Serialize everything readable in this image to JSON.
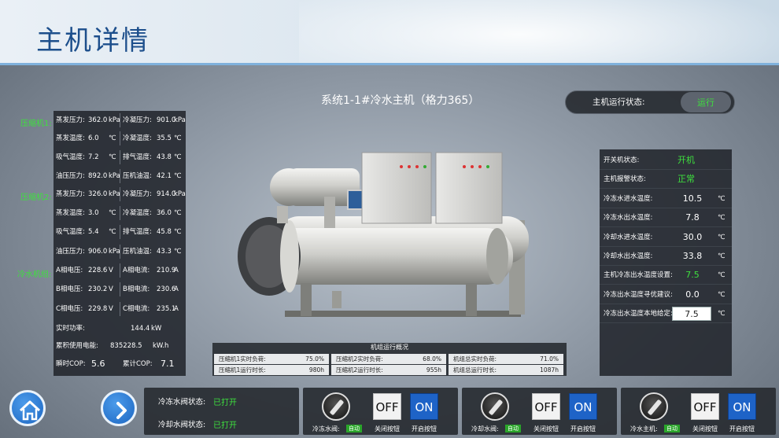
{
  "header": {
    "title": "主机详情"
  },
  "system_title": "系统1-1#冷水主机（格力365）",
  "run_status": {
    "label": "主机运行状态:",
    "value": "运行"
  },
  "compressor_groups": [
    {
      "label": "压缩机1:"
    },
    {
      "label": "压缩机2:"
    },
    {
      "label": "冷水机组:"
    }
  ],
  "left_rows": [
    {
      "k1": "蒸发压力:",
      "v1": "362.0",
      "u1": "kPa",
      "k2": "冷凝压力:",
      "v2": "901.0",
      "u2": "kPa"
    },
    {
      "k1": "蒸发温度:",
      "v1": "6.0",
      "u1": "℃",
      "k2": "冷凝温度:",
      "v2": "35.5",
      "u2": "℃"
    },
    {
      "k1": "吸气温度:",
      "v1": "7.2",
      "u1": "℃",
      "k2": "排气温度:",
      "v2": "43.8",
      "u2": "℃"
    },
    {
      "k1": "油压压力:",
      "v1": "892.0",
      "u1": "kPa",
      "k2": "压机油温:",
      "v2": "42.1",
      "u2": "℃"
    },
    {
      "k1": "蒸发压力:",
      "v1": "326.0",
      "u1": "kPa",
      "k2": "冷凝压力:",
      "v2": "914.0",
      "u2": "kPa"
    },
    {
      "k1": "蒸发温度:",
      "v1": "3.0",
      "u1": "℃",
      "k2": "冷凝温度:",
      "v2": "36.0",
      "u2": "℃"
    },
    {
      "k1": "吸气温度:",
      "v1": "5.4",
      "u1": "℃",
      "k2": "排气温度:",
      "v2": "45.8",
      "u2": "℃"
    },
    {
      "k1": "油压压力:",
      "v1": "906.0",
      "u1": "kPa",
      "k2": "压机油温:",
      "v2": "43.3",
      "u2": "℃"
    },
    {
      "k1": "A相电压:",
      "v1": "228.6",
      "u1": "V",
      "k2": "A相电流:",
      "v2": "210.9",
      "u2": "A"
    },
    {
      "k1": "B相电压:",
      "v1": "230.2",
      "u1": "V",
      "k2": "B相电流:",
      "v2": "230.6",
      "u2": "A"
    },
    {
      "k1": "C相电压:",
      "v1": "229.8",
      "u1": "V",
      "k2": "C相电流:",
      "v2": "235.1",
      "u2": "A"
    }
  ],
  "power": {
    "label": "实时功率:",
    "value": "144.4",
    "unit": "kW"
  },
  "energy": {
    "label": "累积使用电能:",
    "value": "835228.5",
    "unit": "kW.h"
  },
  "cop": {
    "instant_label": "瞬时COP:",
    "instant": "5.6",
    "cumulative_label": "累计COP:",
    "cumulative": "7.1"
  },
  "right_rows": [
    {
      "k": "开关机状态:",
      "v": "开机",
      "u": "",
      "style": "green"
    },
    {
      "k": "主机报警状态:",
      "v": "正常",
      "u": "",
      "style": "green"
    },
    {
      "k": "冷冻水进水温度:",
      "v": "10.5",
      "u": "℃",
      "style": ""
    },
    {
      "k": "冷冻水出水温度:",
      "v": "7.8",
      "u": "℃",
      "style": ""
    },
    {
      "k": "冷却水进水温度:",
      "v": "30.0",
      "u": "℃",
      "style": ""
    },
    {
      "k": "冷却水出水温度:",
      "v": "33.8",
      "u": "℃",
      "style": ""
    },
    {
      "k": "主机冷冻出水温度设置:",
      "v": "7.5",
      "u": "℃",
      "style": "green"
    },
    {
      "k": "冷冻出水温度寻优建议:",
      "v": "0.0",
      "u": "℃",
      "style": ""
    },
    {
      "k": "冷冻出水温度本地给定:",
      "v": "7.5",
      "u": "℃",
      "style": "box"
    }
  ],
  "overview": {
    "title": "机组运行概况",
    "cells": [
      {
        "k": "压缩机1实时负荷:",
        "v": "75.0%"
      },
      {
        "k": "压缩机2实时负荷:",
        "v": "68.0%"
      },
      {
        "k": "机组总实时负荷:",
        "v": "71.0%"
      },
      {
        "k": "压缩机1运行时长:",
        "v": "980h"
      },
      {
        "k": "压缩机2运行时长:",
        "v": "955h"
      },
      {
        "k": "机组总运行时长:",
        "v": "1087h"
      }
    ]
  },
  "valves": [
    {
      "k": "冷冻水阀状态:",
      "v": "已打开"
    },
    {
      "k": "冷却水阀状态:",
      "v": "已打开"
    }
  ],
  "controls": [
    {
      "name": "冷冻水阀:",
      "auto": "自动",
      "off": "OFF",
      "on": "ON",
      "off_label": "关闭按钮",
      "on_label": "开启按钮"
    },
    {
      "name": "冷却水阀:",
      "auto": "自动",
      "off": "OFF",
      "on": "ON",
      "off_label": "关闭按钮",
      "on_label": "开启按钮"
    },
    {
      "name": "冷水主机:",
      "auto": "自动",
      "off": "OFF",
      "on": "ON",
      "off_label": "关闭按钮",
      "on_label": "开启按钮"
    }
  ]
}
